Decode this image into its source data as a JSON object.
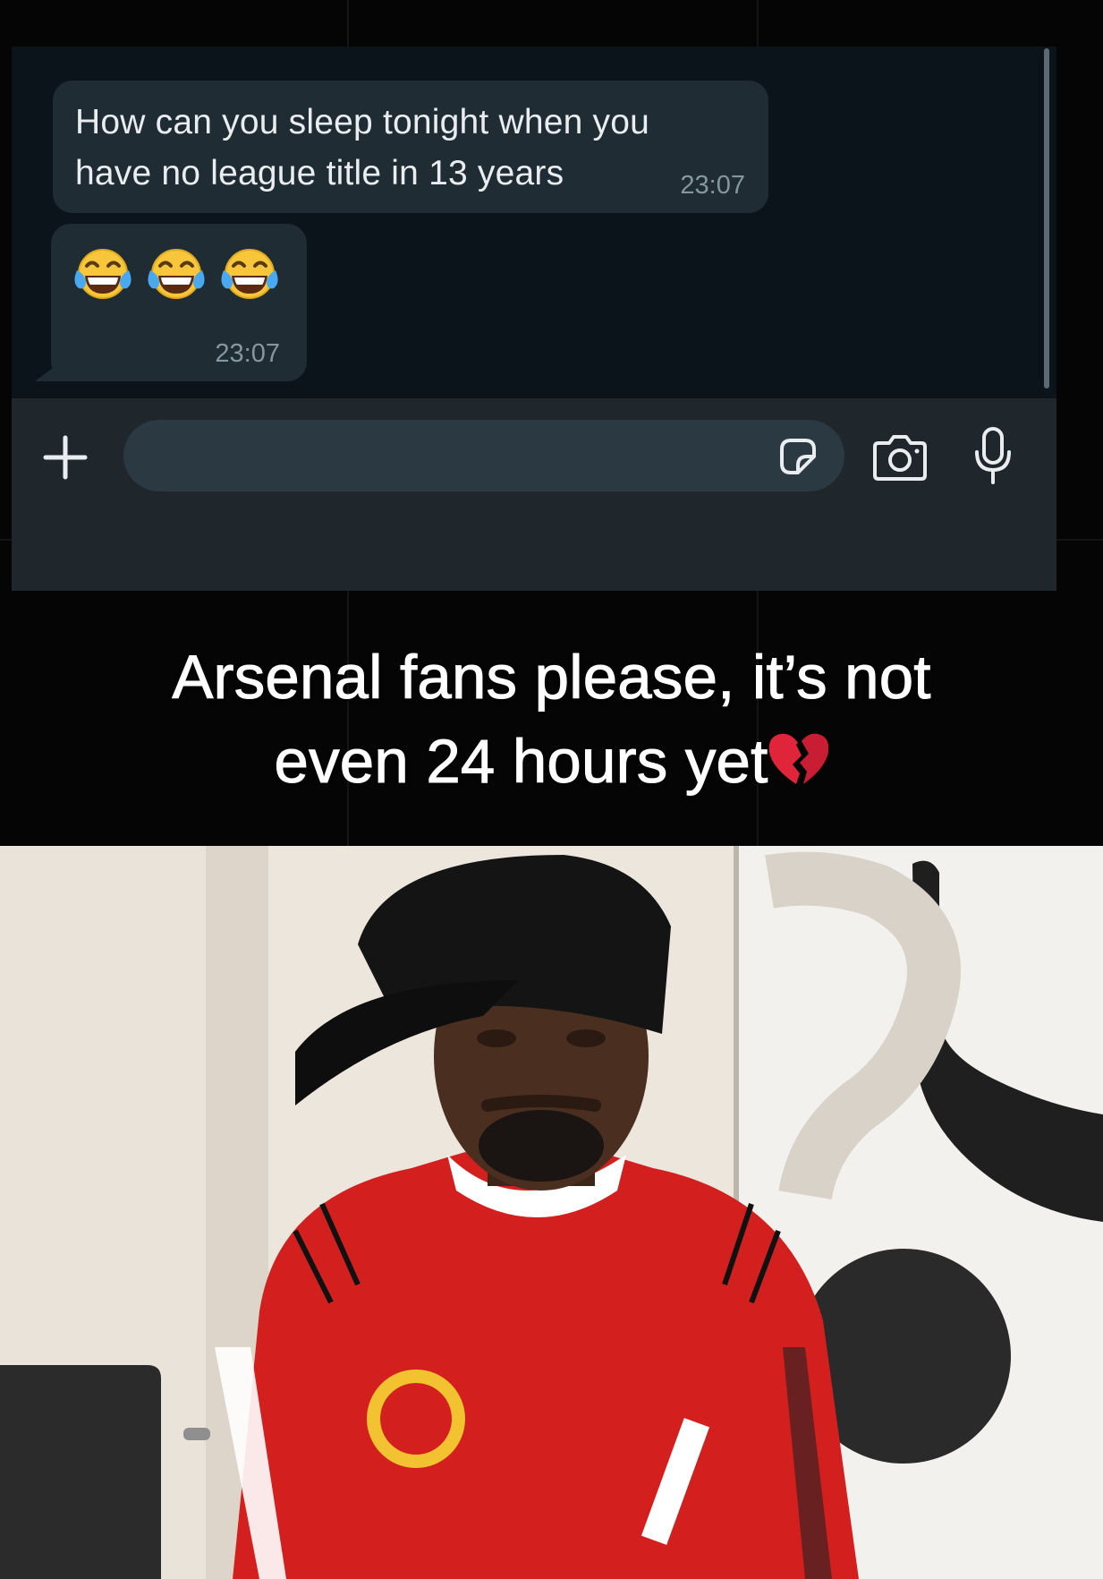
{
  "chat": {
    "messages": [
      {
        "text": "How can you sleep tonight when you have no league title in 13 years",
        "time": "23:07"
      },
      {
        "emoji": [
          "face-with-tears-of-joy",
          "face-with-tears-of-joy",
          "face-with-tears-of-joy"
        ],
        "time": "23:07"
      }
    ],
    "input": {
      "value": "",
      "placeholder": ""
    },
    "icons": {
      "add": "plus-icon",
      "sticker": "sticker-icon",
      "camera": "camera-icon",
      "microphone": "microphone-icon"
    }
  },
  "caption": {
    "line1": "Arsenal fans please, it’s not",
    "line2": "even 24 hours yet",
    "emoji": "broken-heart"
  },
  "photo": {
    "subject": "man-in-red-jersey-and-black-cap"
  },
  "colors": {
    "chat_bg": "#0b141a",
    "bubble": "#1f2c34",
    "input_bar": "#1f272d",
    "text_primary": "#e9edef",
    "text_meta": "#8696a0",
    "jersey_red": "#d41f1f"
  }
}
